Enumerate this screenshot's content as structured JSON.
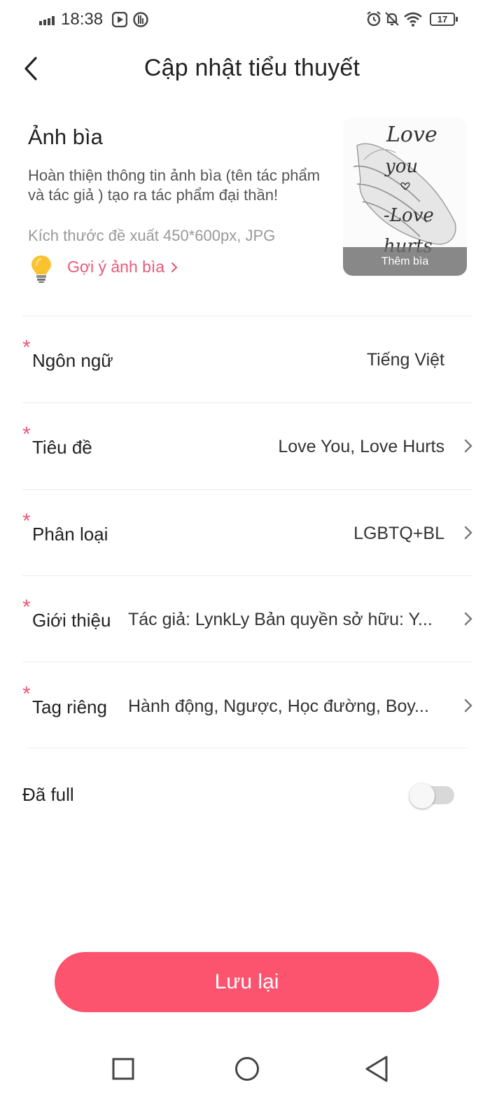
{
  "status_bar": {
    "time": "18:38",
    "battery": "17"
  },
  "header": {
    "title": "Cập nhật tiểu thuyết"
  },
  "cover": {
    "heading": "Ảnh bìa",
    "description": "Hoàn thiện thông tin ảnh bìa (tên tác phẩm và tác giả ) tạo ra tác phẩm đại thần!",
    "size_hint": "Kích thước đề xuất 450*600px, JPG",
    "suggest_link": "Gợi ý ảnh bìa",
    "image_text_1": "Love",
    "image_text_2": "you",
    "image_text_3": "-Love",
    "image_text_4": "hurts",
    "overlay_label": "Thêm bìa"
  },
  "form": {
    "rows": [
      {
        "label": "Ngôn ngữ",
        "value": "Tiếng Việt",
        "required": "*"
      },
      {
        "label": "Tiêu đề",
        "value": "Love You, Love Hurts",
        "required": "*"
      },
      {
        "label": "Phân loại",
        "value": "LGBTQ+BL",
        "required": "*"
      },
      {
        "label": "Giới thiệu",
        "value": "Tác giả: LynkLy Bản quyền sở hữu: Y...",
        "required": "*"
      },
      {
        "label": "Tag riêng",
        "value": "Hành động, Ngược, Học đường, Boy...",
        "required": "*"
      }
    ],
    "full_label": "Đã full",
    "full_enabled": false
  },
  "save_button": "Lưu lại",
  "colors": {
    "accent": "#fc546e",
    "link": "#e85a78",
    "divider": "#ececec"
  },
  "icons": [
    "signal-icon",
    "media-icon",
    "app-icon",
    "alarm-icon",
    "mute-icon",
    "wifi-icon",
    "battery-icon",
    "back-icon",
    "bulb-icon",
    "chevron-right-icon",
    "square-nav-icon",
    "circle-nav-icon",
    "triangle-nav-icon"
  ]
}
